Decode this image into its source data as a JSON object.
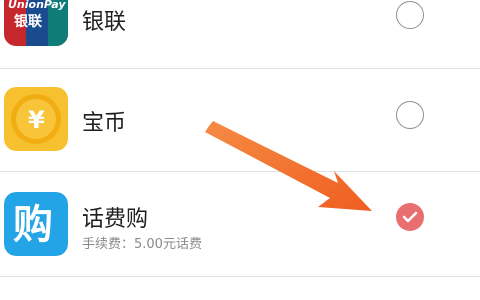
{
  "payment_methods": [
    {
      "name": "银联",
      "logo_text": "UnionPay",
      "logo_subtext": "银联",
      "selected": false,
      "icon": "unionpay-logo"
    },
    {
      "name": "宝币",
      "logo_text": "¥",
      "selected": false,
      "icon": "coin-icon"
    },
    {
      "name": "话费购",
      "logo_text": "购",
      "detail": "手续费：5.00元话费",
      "selected": true,
      "icon": "phone-bill-icon"
    }
  ],
  "colors": {
    "accent_selected": "#e86e70",
    "arrow": "#f06a2a",
    "text_primary": "#1f1f1f",
    "text_secondary": "#8a8a8a",
    "divider": "#e3e3e3"
  }
}
